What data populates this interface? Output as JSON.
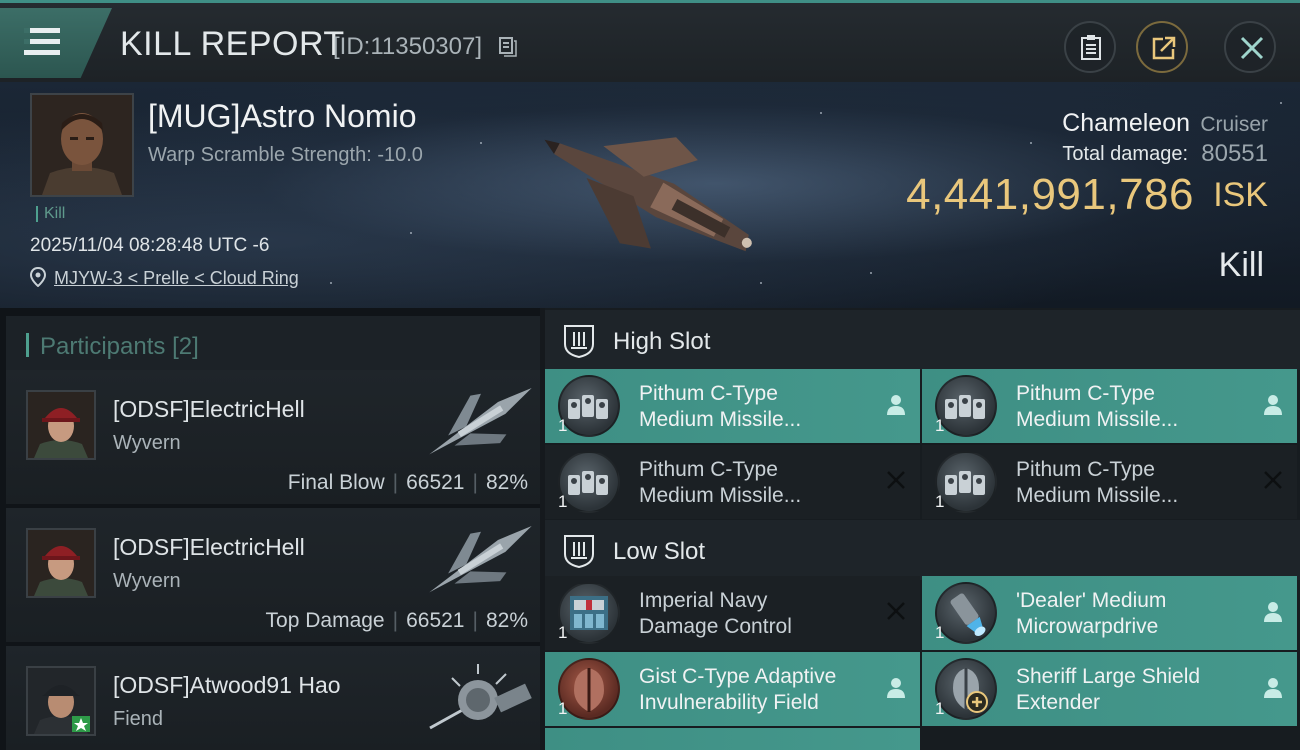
{
  "header": {
    "title": "KILL REPORT",
    "report_id": "[ID:11350307]"
  },
  "victim": {
    "name": "[MUG]Astro Nomio",
    "warp_scramble": "Warp Scramble Strength: -10.0",
    "type_tag": "Kill",
    "datetime": "2025/11/04 08:28:48 UTC -6",
    "location": "MJYW-3 < Prelle < Cloud Ring",
    "ship_name": "Chameleon",
    "ship_class": "Cruiser",
    "total_damage_label": "Total damage:",
    "total_damage": "80551",
    "isk_value": "4,441,991,786",
    "isk_label": "ISK",
    "result": "Kill"
  },
  "participants": {
    "label": "Participants",
    "count": "[2]",
    "list": [
      {
        "name": "[ODSF]ElectricHell",
        "ship": "Wyvern",
        "role": "Final Blow",
        "damage": "66521",
        "percent": "82%"
      },
      {
        "name": "[ODSF]ElectricHell",
        "ship": "Wyvern",
        "role": "Top Damage",
        "damage": "66521",
        "percent": "82%"
      },
      {
        "name": "[ODSF]Atwood91 Hao",
        "ship": "Fiend"
      }
    ]
  },
  "slots": {
    "high": {
      "title": "High Slot",
      "modules": [
        {
          "name_line1": "Pithum C-Type",
          "name_line2": "Medium Missile...",
          "qty": "1",
          "status": "fitted"
        },
        {
          "name_line1": "Pithum C-Type",
          "name_line2": "Medium Missile...",
          "qty": "1",
          "status": "fitted"
        },
        {
          "name_line1": "Pithum C-Type",
          "name_line2": "Medium Missile...",
          "qty": "1",
          "status": "destroyed"
        },
        {
          "name_line1": "Pithum C-Type",
          "name_line2": "Medium Missile...",
          "qty": "1",
          "status": "destroyed"
        }
      ]
    },
    "low": {
      "title": "Low Slot",
      "modules": [
        {
          "name_line1": "Imperial Navy",
          "name_line2": "Damage Control",
          "qty": "1",
          "status": "destroyed"
        },
        {
          "name_line1": "'Dealer' Medium",
          "name_line2": "Microwarpdrive",
          "qty": "1",
          "status": "fitted"
        },
        {
          "name_line1": "Gist C-Type Adaptive",
          "name_line2": "Invulnerability Field",
          "qty": "1",
          "status": "fitted"
        },
        {
          "name_line1": "Sheriff Large Shield",
          "name_line2": "Extender",
          "qty": "1",
          "status": "fitted"
        }
      ]
    }
  },
  "icons": {
    "menu": "menu-icon",
    "copy": "copy-icon",
    "clipboard": "clipboard-icon",
    "share": "share-icon",
    "close": "close-icon",
    "location": "location-pin-icon",
    "slot": "slot-shield-icon",
    "dropped": "person-icon",
    "destroyed": "x-icon"
  },
  "colors": {
    "accent": "#45988c",
    "isk": "#e9c77c",
    "background": "#15191d"
  }
}
